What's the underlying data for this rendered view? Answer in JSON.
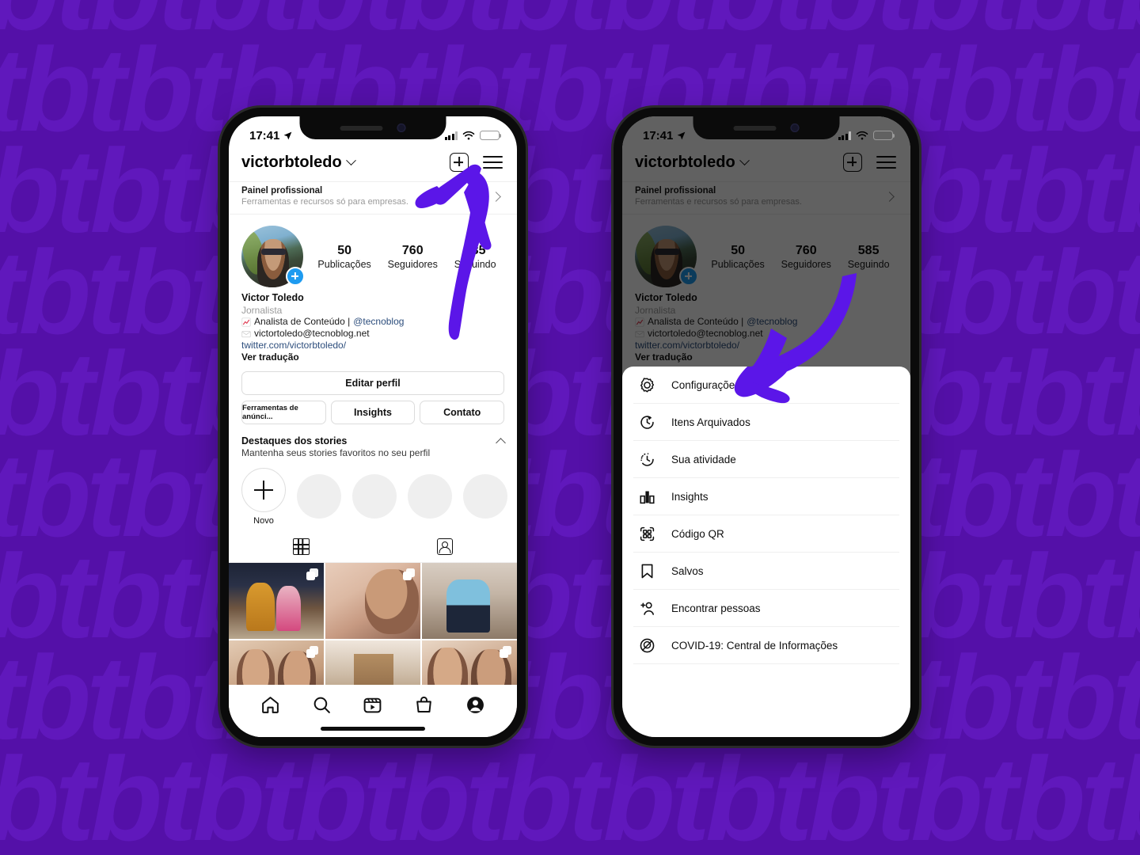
{
  "background": {
    "color": "#5410A8",
    "watermark_text": "tbtbtbtbtbtbtbtbtbtbtbtbtbtbtbtbtb",
    "watermark_color": "#6018BC"
  },
  "annotation": {
    "arrow_color": "#5B16E8",
    "arrow_up_name": "hand-drawn-up-arrow-to-hamburger-menu",
    "arrow_down_name": "hand-drawn-down-arrow-to-configuracoes"
  },
  "phones": [
    {
      "id": "left",
      "status_bar": {
        "time": "17:41",
        "location_icon": "location-arrow-icon",
        "battery_level": "42%"
      },
      "header": {
        "username": "victorbtoledo",
        "dropdown_icon": "chevron-down-icon",
        "add_icon": "plus-square-icon",
        "menu_icon": "hamburger-menu-icon"
      },
      "professional_panel": {
        "title": "Painel profissional",
        "subtitle": "Ferramentas e recursos só para empresas.",
        "chevron": "chevron-right-icon"
      },
      "profile": {
        "avatar_name": "profile-avatar",
        "add_story_badge": "add-story-plus-badge",
        "stats": [
          {
            "value": "50",
            "label": "Publicações"
          },
          {
            "value": "760",
            "label": "Seguidores"
          },
          {
            "value": "585",
            "label": "Seguindo"
          }
        ],
        "full_name": "Victor Toledo",
        "category": "Jornalista",
        "bio_line_1": "Analista de Conteúdo | ",
        "bio_mention": "@tecnoblog",
        "bio_line_2": "victortoledo@tecnoblog.net",
        "bio_link": "twitter.com/victorbtoledo/",
        "translate_label": "Ver tradução"
      },
      "buttons": {
        "edit_profile": "Editar perfil",
        "ad_tools": "Ferramentas de anúnci...",
        "insights": "Insights",
        "contact": "Contato"
      },
      "highlights": {
        "title": "Destaques dos stories",
        "subtitle": "Mantenha seus stories favoritos no seu perfil",
        "collapse_icon": "chevron-up-icon",
        "new_label": "Novo",
        "empty_count": 4
      },
      "tabs": [
        {
          "name": "grid-tab",
          "icon": "grid-icon",
          "active": true
        },
        {
          "name": "tagged-tab",
          "icon": "tagged-person-icon",
          "active": false
        }
      ],
      "grid_cells": [
        {
          "name": "post-1",
          "multi": true
        },
        {
          "name": "post-2",
          "multi": true
        },
        {
          "name": "post-3",
          "multi": false
        },
        {
          "name": "post-4",
          "multi": true
        },
        {
          "name": "post-5",
          "multi": false
        },
        {
          "name": "post-6",
          "multi": true
        }
      ],
      "bottom_nav": [
        {
          "name": "home-icon",
          "active": false
        },
        {
          "name": "search-icon",
          "active": false
        },
        {
          "name": "reels-icon",
          "active": false
        },
        {
          "name": "shop-icon",
          "active": false
        },
        {
          "name": "profile-icon",
          "active": true
        }
      ]
    },
    {
      "id": "right",
      "status_bar": {
        "time": "17:41",
        "location_icon": "location-arrow-icon",
        "battery_level": "42%"
      },
      "header": {
        "username": "victorbtoledo",
        "dropdown_icon": "chevron-down-icon",
        "add_icon": "plus-square-icon",
        "menu_icon": "hamburger-menu-icon"
      },
      "professional_panel": {
        "title": "Painel profissional",
        "subtitle": "Ferramentas e recursos só para empresas.",
        "chevron": "chevron-right-icon"
      },
      "profile": {
        "avatar_name": "profile-avatar",
        "add_story_badge": "add-story-plus-badge",
        "stats": [
          {
            "value": "50",
            "label": "Publicações"
          },
          {
            "value": "760",
            "label": "Seguidores"
          },
          {
            "value": "585",
            "label": "Seguindo"
          }
        ],
        "full_name": "Victor Toledo",
        "category": "Jornalista",
        "bio_line_1": "Analista de Conteúdo | ",
        "bio_mention": "@tecnoblog",
        "bio_line_2": "victortoledo@tecnoblog.net",
        "bio_link": "twitter.com/victorbtoledo/",
        "translate_label": "Ver tradução"
      },
      "menu_sheet": [
        {
          "label": "Configurações",
          "icon": "settings-gear-icon"
        },
        {
          "label": "Itens Arquivados",
          "icon": "archive-clock-icon"
        },
        {
          "label": "Sua atividade",
          "icon": "activity-clock-icon"
        },
        {
          "label": "Insights",
          "icon": "bar-chart-icon"
        },
        {
          "label": "Código QR",
          "icon": "qr-code-icon"
        },
        {
          "label": "Salvos",
          "icon": "bookmark-icon"
        },
        {
          "label": "Encontrar pessoas",
          "icon": "add-person-icon"
        },
        {
          "label": "COVID-19: Central de Informações",
          "icon": "covid-info-icon"
        }
      ]
    }
  ]
}
